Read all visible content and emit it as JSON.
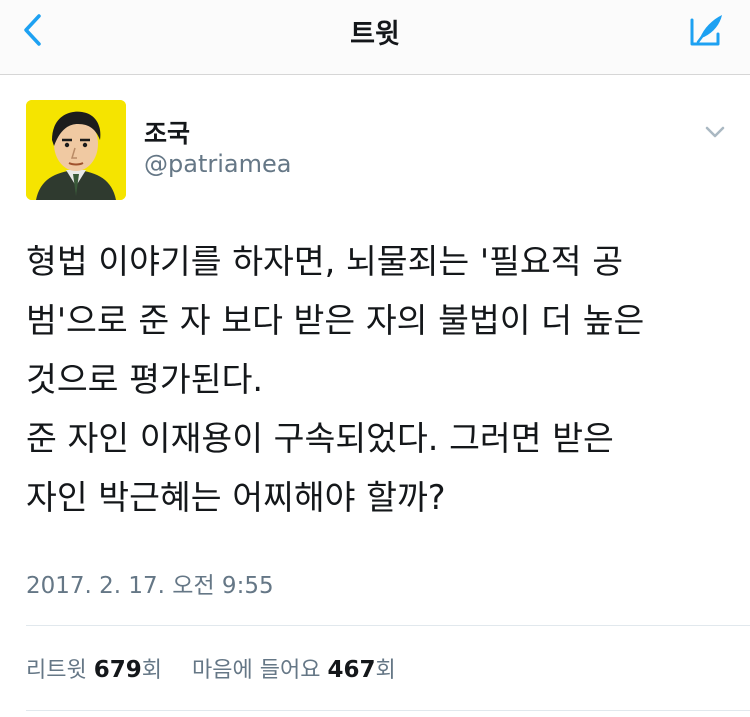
{
  "header": {
    "title": "트윗",
    "back_icon": "chevron-left-icon",
    "compose_icon": "compose-tweet-icon",
    "accent_color": "#1da1f2"
  },
  "tweet": {
    "author": {
      "display_name": "조국",
      "handle": "@patriamea",
      "avatar_icon": "cartoon-portrait-avatar"
    },
    "text_lines": [
      "형법 이야기를 하자면, 뇌물죄는 '필요적 공",
      "범'으로 준 자 보다 받은 자의 불법이 더 높은",
      "것으로 평가된다.",
      "준 자인 이재용이 구속되었다. 그러면 받은",
      "자인 박근혜는 어찌해야 할까?"
    ],
    "timestamp": "2017. 2. 17. 오전 9:55",
    "stats": {
      "retweets_label": "리트윗",
      "retweets_count": "679",
      "retweets_unit": "회",
      "likes_label": "마음에 들어요",
      "likes_count": "467",
      "likes_unit": "회"
    }
  }
}
